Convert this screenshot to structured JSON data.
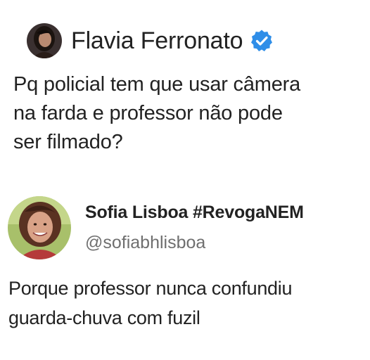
{
  "top_tweet": {
    "author_name": "Flavia Ferronato",
    "verified_icon": "verified-badge-icon",
    "text_lines": [
      "Pq policial tem que usar câmera",
      "na farda e professor não pode",
      "ser filmado?"
    ]
  },
  "reply_tweet": {
    "author_name": "Sofia Lisboa #RevogaNEM",
    "handle": "@sofiabhlisboa",
    "text_lines": [
      "Porque professor nunca confundiu",
      "guarda-chuva com fuzil"
    ]
  },
  "colors": {
    "verified_blue": "#2f8ee8",
    "text_dark": "#222222",
    "handle_gray": "#6f6f6f"
  }
}
